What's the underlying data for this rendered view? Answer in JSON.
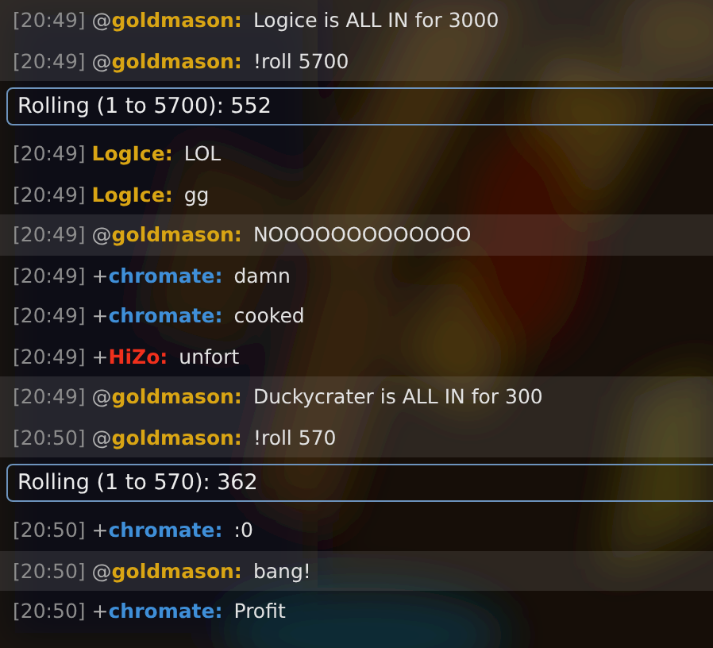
{
  "messages": [
    {
      "kind": "message",
      "time": "[20:49]",
      "prefix": "@",
      "user": "goldmason:",
      "color": "#d9a514",
      "text": "Logice is ALL IN for 3000",
      "highlighted": true
    },
    {
      "kind": "message",
      "time": "[20:49]",
      "prefix": "@",
      "user": "goldmason:",
      "color": "#d9a514",
      "text": "!roll 5700",
      "highlighted": true
    },
    {
      "kind": "roll",
      "text": "Rolling (1 to 5700): 552"
    },
    {
      "kind": "message",
      "time": "[20:49]",
      "user": "LogIce:",
      "color": "#d9a514",
      "text": "LOL",
      "highlighted": false
    },
    {
      "kind": "message",
      "time": "[20:49]",
      "user": "LogIce:",
      "color": "#d9a514",
      "text": "gg",
      "highlighted": false
    },
    {
      "kind": "message",
      "time": "[20:49]",
      "prefix": "@",
      "user": "goldmason:",
      "color": "#d9a514",
      "text": "NOOOOOOOOOOOOO",
      "highlighted": true
    },
    {
      "kind": "message",
      "time": "[20:49]",
      "prefix": "+",
      "user": "chromate:",
      "color": "#3f8fd8",
      "text": "damn",
      "highlighted": false
    },
    {
      "kind": "message",
      "time": "[20:49]",
      "prefix": "+",
      "user": "chromate:",
      "color": "#3f8fd8",
      "text": "cooked",
      "highlighted": false
    },
    {
      "kind": "message",
      "time": "[20:49]",
      "prefix": "+",
      "user": "HiZo:",
      "color": "#f0301c",
      "text": "unfort",
      "highlighted": false
    },
    {
      "kind": "message",
      "time": "[20:49]",
      "prefix": "@",
      "user": "goldmason:",
      "color": "#d9a514",
      "text": "Duckycrater is ALL IN for 300",
      "highlighted": true
    },
    {
      "kind": "message",
      "time": "[20:50]",
      "prefix": "@",
      "user": "goldmason:",
      "color": "#d9a514",
      "text": "!roll 570",
      "highlighted": true
    },
    {
      "kind": "roll",
      "text": "Rolling (1 to 570): 362"
    },
    {
      "kind": "message",
      "time": "[20:50]",
      "prefix": "+",
      "user": "chromate:",
      "color": "#3f8fd8",
      "text": ":0",
      "highlighted": false
    },
    {
      "kind": "message",
      "time": "[20:50]",
      "prefix": "@",
      "user": "goldmason:",
      "color": "#d9a514",
      "text": "bang!",
      "highlighted": true
    },
    {
      "kind": "message",
      "time": "[20:50]",
      "prefix": "+",
      "user": "chromate:",
      "color": "#3f8fd8",
      "text": "Profit",
      "highlighted": false
    }
  ]
}
